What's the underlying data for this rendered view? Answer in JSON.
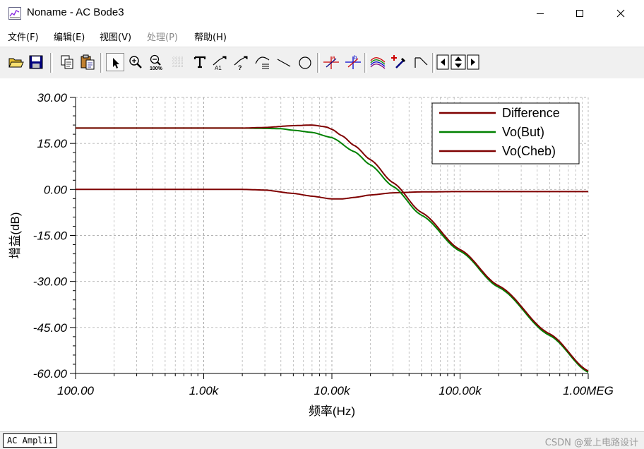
{
  "window": {
    "title": "Noname - AC Bode3"
  },
  "menu": [
    {
      "label": "文件(F)",
      "enabled": true
    },
    {
      "label": "编辑(E)",
      "enabled": true
    },
    {
      "label": "视图(V)",
      "enabled": true
    },
    {
      "label": "处理(P)",
      "enabled": false
    },
    {
      "label": "帮助(H)",
      "enabled": true
    }
  ],
  "toolbar": {
    "icons": [
      "open-folder-icon",
      "save-icon",
      "copy-icon",
      "paste-icon",
      "pointer-icon",
      "zoom-in-icon",
      "zoom-100-icon",
      "grid-icon",
      "text-icon",
      "curve-label-icon",
      "curve-label-query-icon",
      "curve-label-hidden-icon",
      "line-tool-icon",
      "circle-tool-icon",
      "cursor-a-icon",
      "cursor-b-icon",
      "multi-curve-icon",
      "add-curve-icon",
      "slope-icon",
      "arrow-left-icon",
      "arrow-updown-icon",
      "arrow-right-icon"
    ]
  },
  "chart_data": {
    "type": "line",
    "xscale": "log",
    "xlim": [
      100,
      1000000
    ],
    "ylim": [
      -60,
      30
    ],
    "yticks": [
      "30.00",
      "15.00",
      "0.00",
      "-15.00",
      "-30.00",
      "-45.00",
      "-60.00"
    ],
    "xticks": [
      "100.00",
      "1.00k",
      "10.00k",
      "100.00k",
      "1.00MEG"
    ],
    "xlabel": "频率(Hz)",
    "ylabel": "增益(dB)",
    "grid": true,
    "legend": "top-right",
    "series": [
      {
        "name": "Difference",
        "color": "#7f0000",
        "x": [
          100,
          1000,
          2000,
          3000,
          5000,
          7000,
          10000,
          12000,
          15000,
          20000,
          30000,
          50000,
          100000,
          1000000
        ],
        "y": [
          0,
          0,
          0,
          -0.2,
          -1.3,
          -2.2,
          -3.1,
          -3.1,
          -2.6,
          -1.8,
          -1.1,
          -0.8,
          -0.7,
          -0.7
        ]
      },
      {
        "name": "Vo(But)",
        "color": "#008000",
        "x": [
          100,
          1000,
          2000,
          3000,
          4000,
          5000,
          7000,
          10000,
          15000,
          20000,
          30000,
          50000,
          100000,
          200000,
          500000,
          1000000
        ],
        "y": [
          20,
          20,
          20,
          19.9,
          19.8,
          19.3,
          18.6,
          16.9,
          12.3,
          8.0,
          1.0,
          -8.4,
          -20.1,
          -31.9,
          -47.6,
          -59.6
        ]
      },
      {
        "name": "Vo(Cheb)",
        "color": "#7f0000",
        "x": [
          100,
          1000,
          2000,
          3000,
          5000,
          7000,
          9000,
          10000,
          12000,
          15000,
          20000,
          30000,
          50000,
          100000,
          200000,
          500000,
          1000000
        ],
        "y": [
          20,
          20,
          20,
          20.2,
          20.8,
          21.0,
          20.4,
          19.6,
          17.5,
          14.3,
          9.7,
          2.2,
          -7.5,
          -19.6,
          -31.4,
          -47.1,
          -59.2
        ]
      }
    ]
  },
  "status": {
    "tab": "AC Ampli1",
    "watermark": "CSDN @爱上电路设计"
  }
}
